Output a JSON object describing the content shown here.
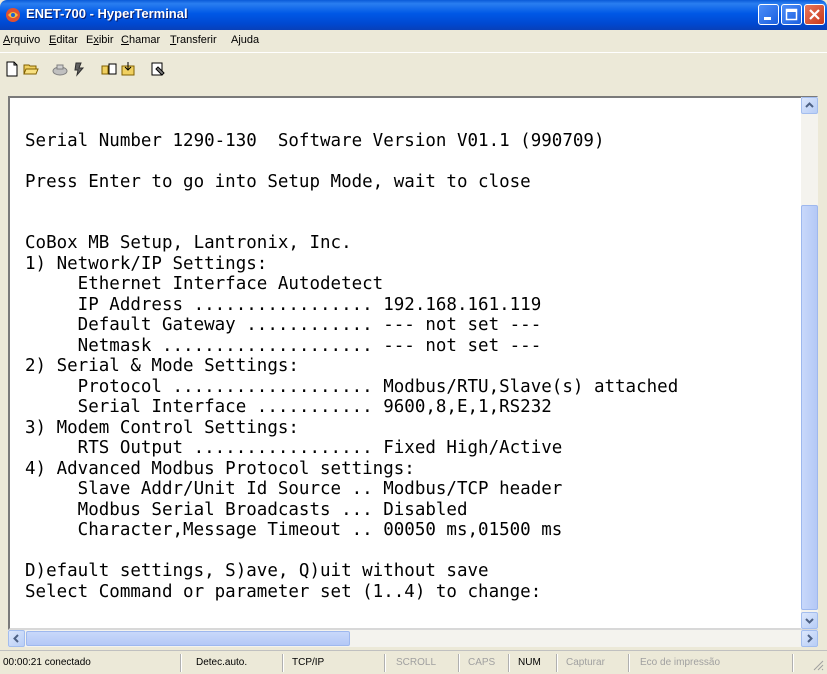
{
  "window": {
    "title": "ENET-700 - HyperTerminal"
  },
  "menu": [
    {
      "label": "Arquivo",
      "mnemonic": "A"
    },
    {
      "label": "Editar",
      "mnemonic": "E"
    },
    {
      "label": "Exibir",
      "mnemonic": "x"
    },
    {
      "label": "Chamar",
      "mnemonic": "C"
    },
    {
      "label": "Transferir",
      "mnemonic": "T"
    },
    {
      "label": "Ajuda",
      "mnemonic": "j"
    }
  ],
  "toolbar": [
    "new-file-icon",
    "open-folder-icon",
    "phone-connect-icon",
    "disconnect-icon",
    "send-icon",
    "receive-icon",
    "properties-icon"
  ],
  "terminal": {
    "lines": [
      "",
      "Serial Number 1290-130  Software Version V01.1 (990709)",
      "",
      "Press Enter to go into Setup Mode, wait to close",
      "",
      "",
      "CoBox MB Setup, Lantronix, Inc.",
      "1) Network/IP Settings:",
      "     Ethernet Interface Autodetect",
      "     IP Address ................. 192.168.161.119",
      "     Default Gateway ............ --- not set ---",
      "     Netmask .................... --- not set ---",
      "2) Serial & Mode Settings:",
      "     Protocol ................... Modbus/RTU,Slave(s) attached",
      "     Serial Interface ........... 9600,8,E,1,RS232",
      "3) Modem Control Settings:",
      "     RTS Output ................. Fixed High/Active",
      "4) Advanced Modbus Protocol settings:",
      "     Slave Addr/Unit Id Source .. Modbus/TCP header",
      "     Modbus Serial Broadcasts ... Disabled",
      "     Character,Message Timeout .. 00050 ms,01500 ms",
      "",
      "D)efault settings, S)ave, Q)uit without save",
      "Select Command or parameter set (1..4) to change:"
    ]
  },
  "status": {
    "connection": "00:00:21 conectado",
    "detect": "Detec.auto.",
    "protocol": "TCP/IP",
    "scroll": "SCROLL",
    "caps": "CAPS",
    "num": "NUM",
    "capture": "Capturar",
    "echo": "Eco de impressão"
  },
  "colors": {
    "titlebar": "#0058e6",
    "chrome": "#ece9d8",
    "terminal_bg": "#ffffff"
  }
}
